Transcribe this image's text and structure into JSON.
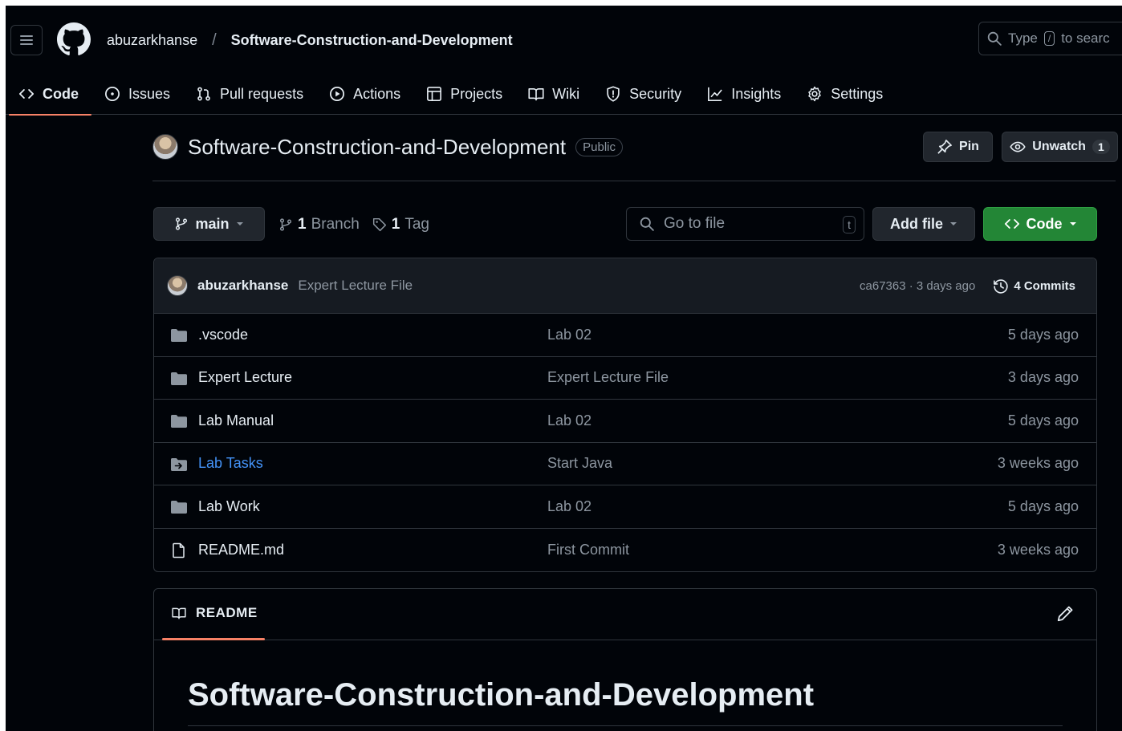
{
  "header": {
    "owner": "abuzarkhanse",
    "separator": "/",
    "repo": "Software-Construction-and-Development",
    "search": {
      "prefix": "Type",
      "key": "/",
      "suffix": "to searc"
    }
  },
  "tabs": [
    {
      "label": "Code",
      "icon": "code-icon",
      "active": true
    },
    {
      "label": "Issues",
      "icon": "issue-icon"
    },
    {
      "label": "Pull requests",
      "icon": "pull-request-icon"
    },
    {
      "label": "Actions",
      "icon": "play-icon"
    },
    {
      "label": "Projects",
      "icon": "table-icon"
    },
    {
      "label": "Wiki",
      "icon": "book-icon"
    },
    {
      "label": "Security",
      "icon": "shield-icon"
    },
    {
      "label": "Insights",
      "icon": "graph-icon"
    },
    {
      "label": "Settings",
      "icon": "gear-icon"
    }
  ],
  "repo_header": {
    "name": "Software-Construction-and-Development",
    "visibility": "Public",
    "pin_label": "Pin",
    "unwatch_label": "Unwatch",
    "watch_count": "1"
  },
  "branch_bar": {
    "branch": "main",
    "branch_count": "1",
    "branch_label": "Branch",
    "tag_count": "1",
    "tag_label": "Tag",
    "go_to_file_placeholder": "Go to file",
    "go_to_file_key": "t",
    "add_file_label": "Add file",
    "code_label": "Code"
  },
  "latest_commit": {
    "author": "abuzarkhanse",
    "message": "Expert Lecture File",
    "hash_and_time": "ca67363 · 3 days ago",
    "commits_label": "4 Commits"
  },
  "files": [
    {
      "name": ".vscode",
      "type": "folder",
      "message": "Lab 02",
      "date": "5 days ago"
    },
    {
      "name": "Expert Lecture",
      "type": "folder",
      "message": "Expert Lecture File",
      "date": "3 days ago"
    },
    {
      "name": "Lab Manual",
      "type": "folder",
      "message": "Lab 02",
      "date": "5 days ago"
    },
    {
      "name": "Lab Tasks",
      "type": "submodule",
      "message": "Start Java",
      "date": "3 weeks ago"
    },
    {
      "name": "Lab Work",
      "type": "folder",
      "message": "Lab 02",
      "date": "5 days ago"
    },
    {
      "name": "README.md",
      "type": "file",
      "message": "First Commit",
      "date": "3 weeks ago"
    }
  ],
  "readme": {
    "tab_label": "README",
    "heading": "Software-Construction-and-Development"
  },
  "colors": {
    "background": "#010409",
    "border": "#30363d",
    "accent_underline": "#f78166",
    "primary_button": "#238636",
    "link": "#4493f8"
  }
}
